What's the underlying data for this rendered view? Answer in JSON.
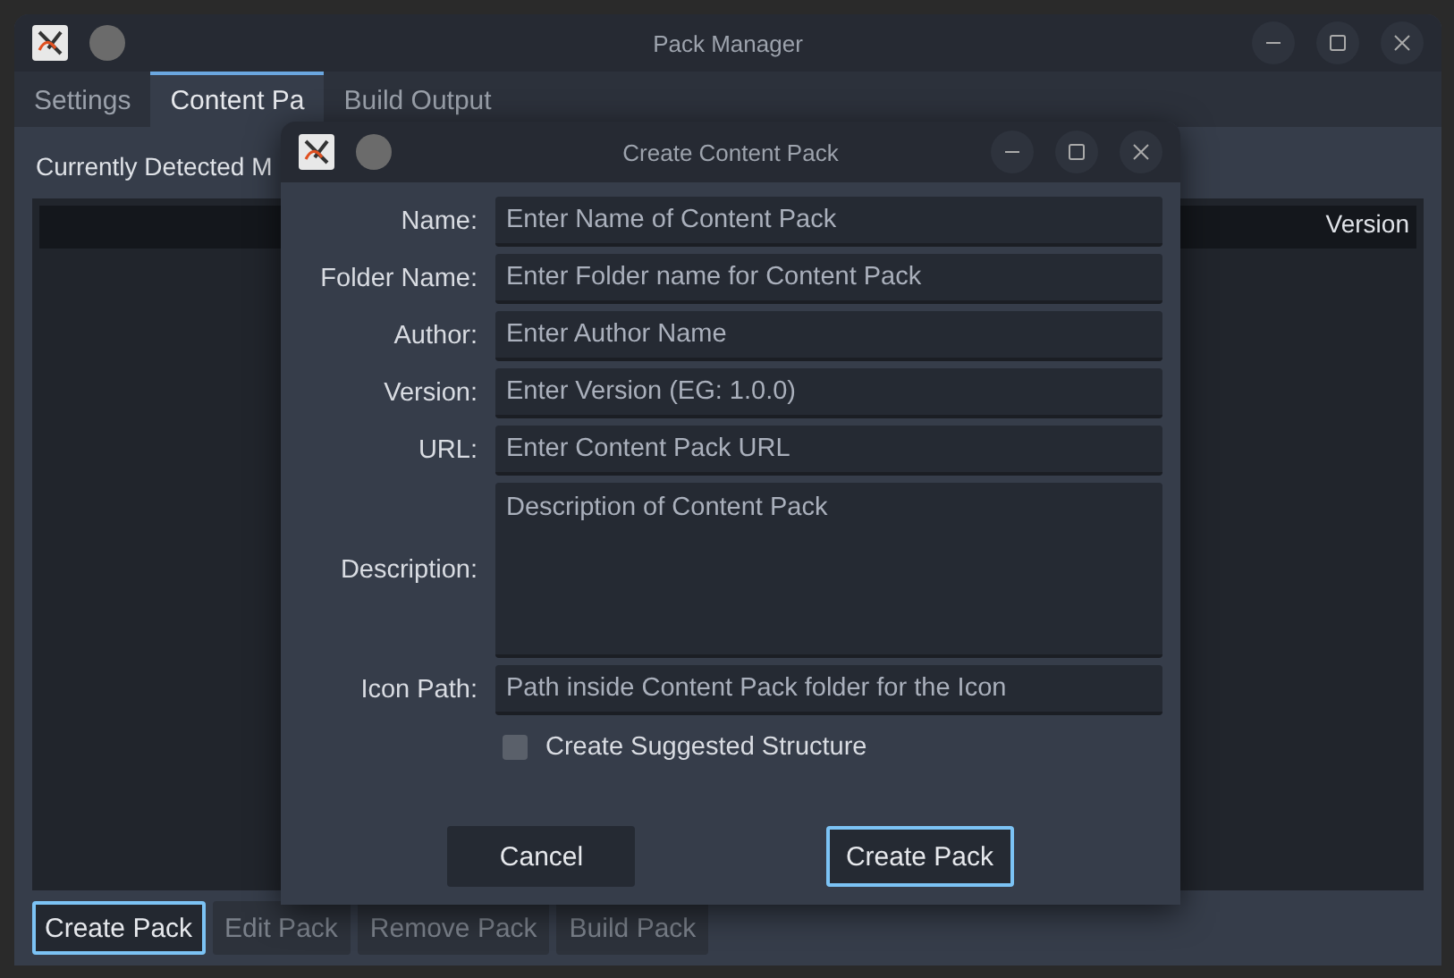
{
  "window": {
    "title": "Pack Manager"
  },
  "tabs": [
    {
      "label": "Settings",
      "selected": false
    },
    {
      "label": "Content Pa",
      "selected": true
    },
    {
      "label": "Build Output",
      "selected": false
    }
  ],
  "section_label": "Currently Detected M",
  "table": {
    "columns": [
      "",
      "Version"
    ]
  },
  "actions": [
    {
      "label": "Create Pack",
      "disabled": false,
      "focused": true
    },
    {
      "label": "Edit Pack",
      "disabled": true,
      "focused": false
    },
    {
      "label": "Remove Pack",
      "disabled": true,
      "focused": false
    },
    {
      "label": "Build Pack",
      "disabled": true,
      "focused": false
    }
  ],
  "dialog": {
    "title": "Create Content Pack",
    "fields": [
      {
        "label": "Name:",
        "placeholder": "Enter Name of Content Pack",
        "kind": "line"
      },
      {
        "label": "Folder Name:",
        "placeholder": "Enter Folder name for Content Pack",
        "kind": "line"
      },
      {
        "label": "Author:",
        "placeholder": "Enter Author Name",
        "kind": "line"
      },
      {
        "label": "Version:",
        "placeholder": "Enter Version (EG: 1.0.0)",
        "kind": "line"
      },
      {
        "label": "URL:",
        "placeholder": "Enter Content Pack URL",
        "kind": "line"
      },
      {
        "label": "Description:",
        "placeholder": "Description of Content Pack",
        "kind": "area"
      },
      {
        "label": "Icon Path:",
        "placeholder": "Path inside Content Pack folder for the Icon",
        "kind": "line"
      }
    ],
    "checkbox": {
      "label": "Create Suggested Structure",
      "checked": false
    },
    "buttons": [
      {
        "label": "Cancel",
        "focused": false
      },
      {
        "label": "Create Pack",
        "focused": true
      }
    ]
  }
}
